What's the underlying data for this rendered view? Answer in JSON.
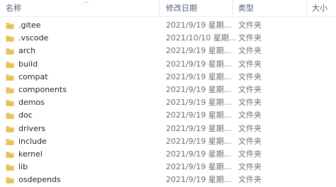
{
  "columns": {
    "name": "名称",
    "date": "修改日期",
    "type": "类型",
    "size": "大小"
  },
  "icons": {
    "folder": "folder-icon",
    "sort": "sort-up-arrow-icon"
  },
  "colors": {
    "folder_body": "#e8c250",
    "folder_tab": "#d9a93a",
    "header_text": "#4c607a"
  },
  "files": [
    {
      "name": ".gitee",
      "date": "2021/9/19 星期...",
      "type": "文件夹"
    },
    {
      "name": ".vscode",
      "date": "2021/10/10 星期...",
      "type": "文件夹"
    },
    {
      "name": "arch",
      "date": "2021/9/19 星期...",
      "type": "文件夹"
    },
    {
      "name": "build",
      "date": "2021/9/19 星期...",
      "type": "文件夹"
    },
    {
      "name": "compat",
      "date": "2021/9/19 星期...",
      "type": "文件夹"
    },
    {
      "name": "components",
      "date": "2021/9/19 星期...",
      "type": "文件夹"
    },
    {
      "name": "demos",
      "date": "2021/9/19 星期...",
      "type": "文件夹"
    },
    {
      "name": "doc",
      "date": "2021/9/19 星期...",
      "type": "文件夹"
    },
    {
      "name": "drivers",
      "date": "2021/9/19 星期...",
      "type": "文件夹"
    },
    {
      "name": "include",
      "date": "2021/9/19 星期...",
      "type": "文件夹"
    },
    {
      "name": "kernel",
      "date": "2021/9/19 星期...",
      "type": "文件夹"
    },
    {
      "name": "lib",
      "date": "2021/9/19 星期...",
      "type": "文件夹"
    },
    {
      "name": "osdepends",
      "date": "2021/9/19 星期...",
      "type": "文件夹"
    }
  ]
}
